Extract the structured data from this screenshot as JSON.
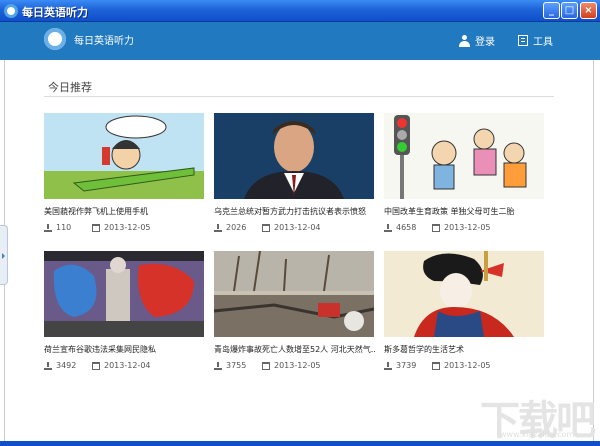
{
  "window": {
    "title": "每日英语听力"
  },
  "header": {
    "app_name": "每日英语听力",
    "login_label": "登录",
    "tools_label": "工具"
  },
  "section": {
    "title": "今日推荐"
  },
  "cards": [
    {
      "title": "美国藐视作弊飞机上使用手机",
      "downloads": "110",
      "date": "2013-12-05",
      "thumb": "cartoon-airplane-phone"
    },
    {
      "title": "乌克兰总统对暂方武力打击抗议者表示愤怒",
      "downloads": "2026",
      "date": "2013-12-04",
      "thumb": "politician-portrait"
    },
    {
      "title": "中国改革生育政策 单独父母可生二胎",
      "downloads": "4658",
      "date": "2013-12-05",
      "thumb": "cartoon-family-traffic-light"
    },
    {
      "title": "荷兰宣布谷歌违法采集网民隐私",
      "downloads": "3492",
      "date": "2013-12-04",
      "thumb": "graffiti-google"
    },
    {
      "title": "青岛爆炸事故死亡人数增至52人 河北天然气...",
      "downloads": "3755",
      "date": "2013-12-05",
      "thumb": "explosion-street"
    },
    {
      "title": "斯多葛哲学的生活艺术",
      "downloads": "3739",
      "date": "2013-12-05",
      "thumb": "ukiyoe-woman"
    }
  ],
  "watermark": {
    "text": "下载吧",
    "url_text": "www.xiazaiba.com"
  },
  "colors": {
    "header_bg": "#2179c0",
    "titlebar": "#1e63d8"
  }
}
